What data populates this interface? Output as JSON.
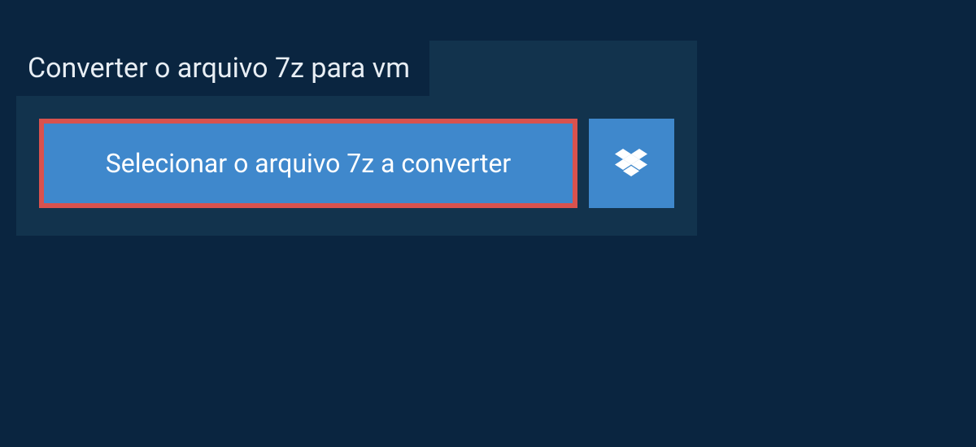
{
  "heading": {
    "title": "Converter o arquivo 7z para vm"
  },
  "actions": {
    "select_file_label": "Selecionar o arquivo 7z a converter"
  }
}
